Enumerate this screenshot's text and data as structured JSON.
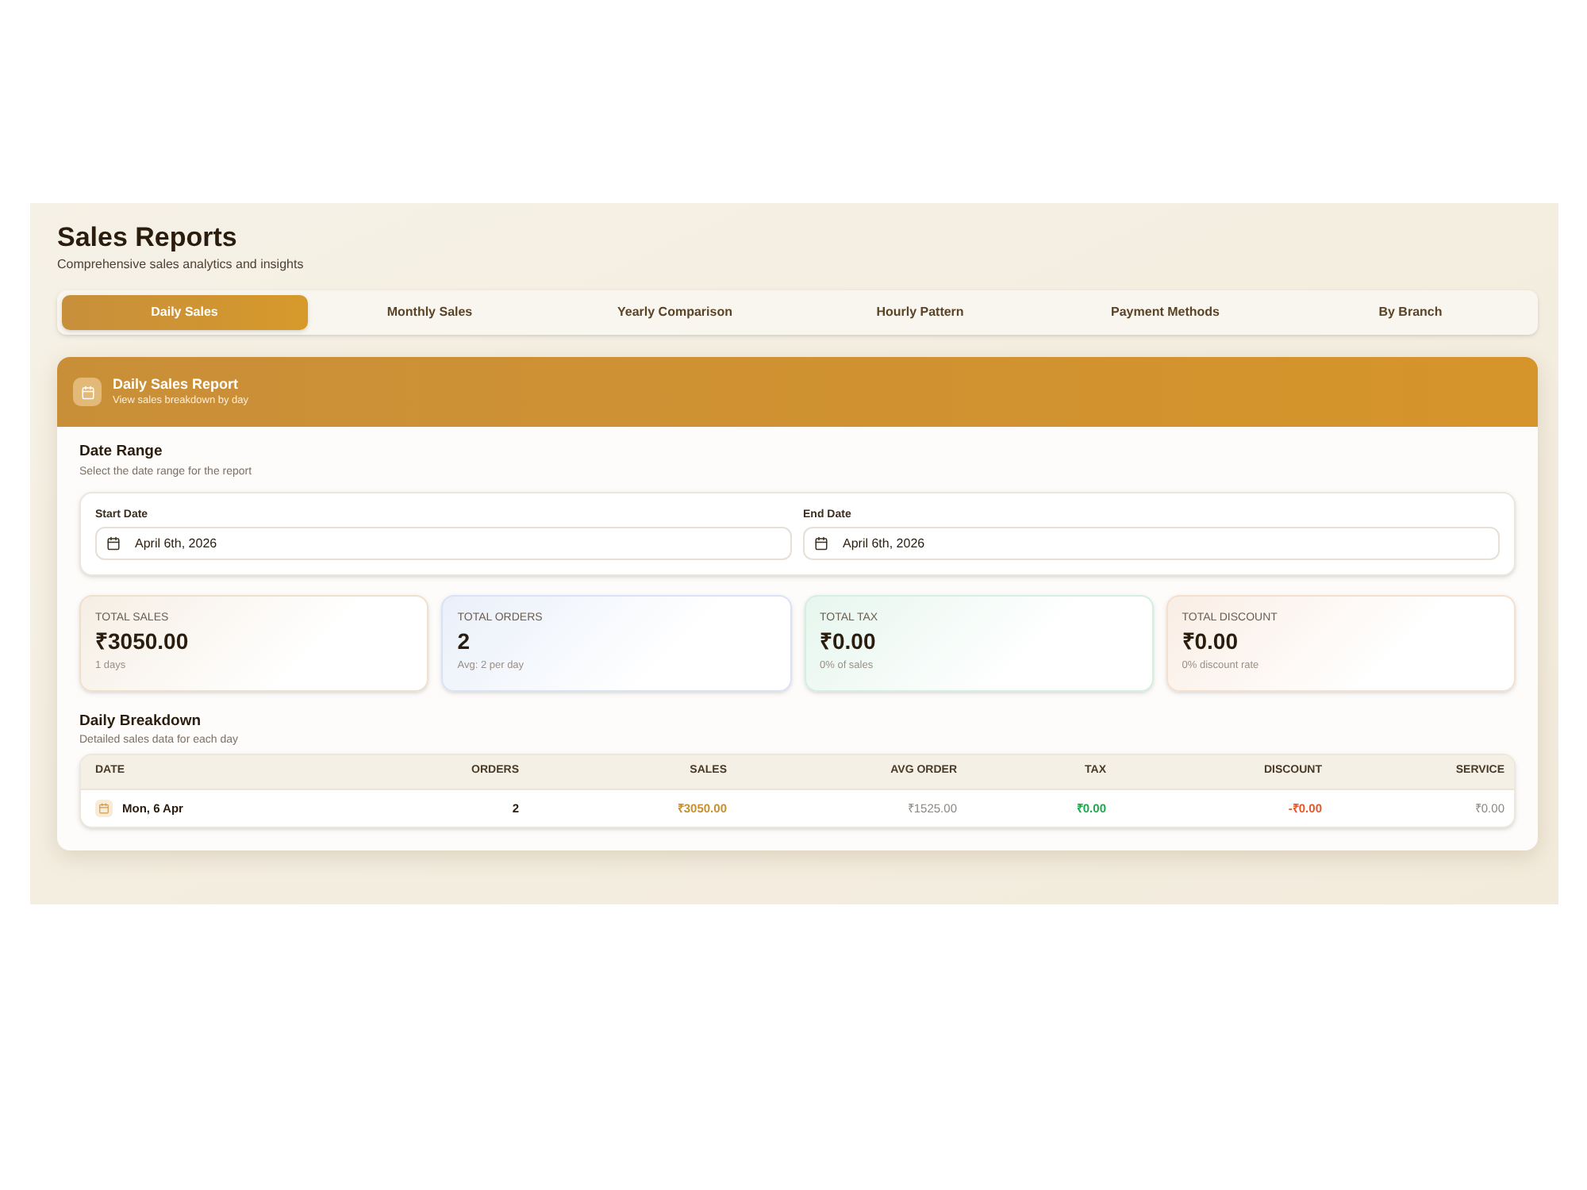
{
  "header": {
    "title": "Sales Reports",
    "subtitle": "Comprehensive sales analytics and insights"
  },
  "tabs": [
    {
      "label": "Daily Sales",
      "selected": true
    },
    {
      "label": "Monthly Sales",
      "selected": false
    },
    {
      "label": "Yearly Comparison",
      "selected": false
    },
    {
      "label": "Hourly Pattern",
      "selected": false
    },
    {
      "label": "Payment Methods",
      "selected": false
    },
    {
      "label": "By Branch",
      "selected": false
    }
  ],
  "report": {
    "title": "Daily Sales Report",
    "subtitle": "View sales breakdown by day"
  },
  "date_range": {
    "title": "Date Range",
    "subtitle": "Select the date range for the report",
    "fields": [
      {
        "label": "Start Date",
        "value": "April 6th, 2026"
      },
      {
        "label": "End Date",
        "value": "April 6th, 2026"
      }
    ]
  },
  "stats": [
    {
      "label": "TOTAL SALES",
      "value": "₹3050.00",
      "note": "1 days",
      "color": "#eee0cd"
    },
    {
      "label": "TOTAL ORDERS",
      "value": "2",
      "note": "Avg: 2 per day",
      "color": "#d8e3f5"
    },
    {
      "label": "TOTAL TAX",
      "value": "₹0.00",
      "note": "0% of sales",
      "color": "#d2efe0"
    },
    {
      "label": "TOTAL DISCOUNT",
      "value": "₹0.00",
      "note": "0% discount rate",
      "color": "#f5dfcf"
    }
  ],
  "breakdown": {
    "title": "Daily Breakdown",
    "subtitle": "Detailed sales data for each day",
    "table": {
      "columns": [
        {
          "label": "DATE",
          "kind": "date"
        },
        {
          "label": "ORDERS",
          "kind": "count"
        },
        {
          "label": "SALES",
          "kind": "highlight"
        },
        {
          "label": "AVG ORDER",
          "kind": "muted"
        },
        {
          "label": "TAX",
          "kind": "positive"
        },
        {
          "label": "DISCOUNT",
          "kind": "negative"
        },
        {
          "label": "SERVICE",
          "kind": "muted"
        }
      ],
      "rows": [
        {
          "cells": [
            "Mon, 6 Apr",
            "2",
            "₹3050.00",
            "₹1525.00",
            "₹0.00",
            "-₹0.00",
            "₹0.00"
          ]
        }
      ]
    }
  }
}
